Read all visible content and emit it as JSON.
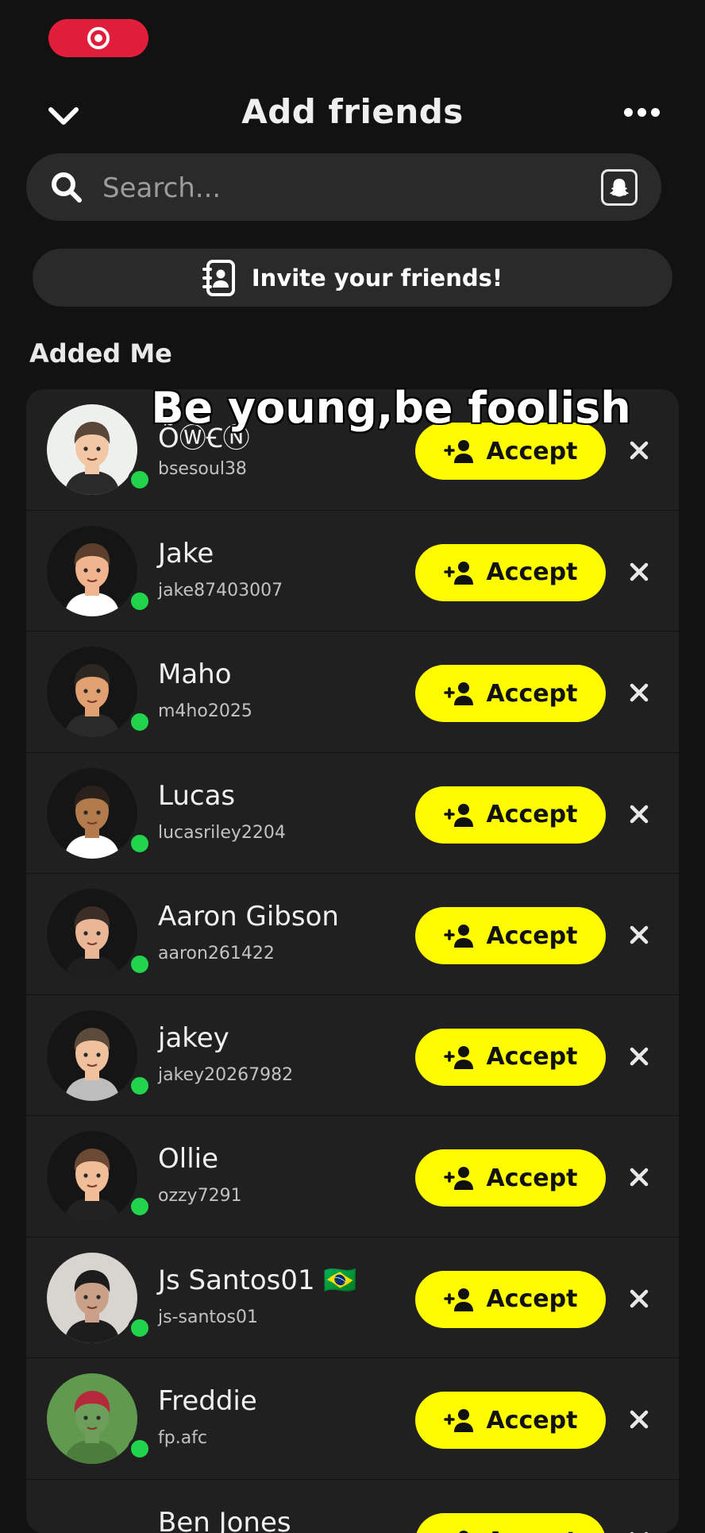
{
  "header": {
    "title": "Add friends",
    "chevron_icon": "chevron-down-icon",
    "more_icon": "more-horizontal-icon"
  },
  "search": {
    "placeholder": "Search...",
    "icon": "search-icon",
    "scan_icon": "snapcode-icon"
  },
  "invite": {
    "label": "Invite your friends!",
    "icon": "contact-book-icon"
  },
  "section_title": "Added Me",
  "accept_label": "Accept",
  "caption": "Be young,be foolish",
  "colors": {
    "accent": "#fffc00",
    "online": "#22d34c",
    "record": "#e01e3c"
  },
  "friends": [
    {
      "name": "ÕⓌꞒⓃ",
      "username": "bsesoul38",
      "avatar": {
        "skin": "#f1c7a6",
        "hair": "#5a4638",
        "bg": "#eef0ee",
        "shirt": "#2a2a2a"
      },
      "online": true
    },
    {
      "name": "Jake",
      "username": "jake87403007",
      "avatar": {
        "skin": "#f0b48e",
        "hair": "#5b3f2c",
        "bg": "#151515",
        "shirt": "#ffffff"
      },
      "online": true
    },
    {
      "name": "Maho",
      "username": "m4ho2025",
      "avatar": {
        "skin": "#e0a070",
        "hair": "#2d2722",
        "bg": "#151515",
        "shirt": "#2a2a2a"
      },
      "online": true
    },
    {
      "name": "Lucas",
      "username": "lucasriley2204",
      "avatar": {
        "skin": "#b37a4c",
        "hair": "#2a211c",
        "bg": "#151515",
        "shirt": "#ffffff"
      },
      "online": true
    },
    {
      "name": "Aaron Gibson",
      "username": "aaron261422",
      "avatar": {
        "skin": "#eab796",
        "hair": "#3b2e27",
        "bg": "#151515",
        "shirt": "#1e1e1e"
      },
      "online": true
    },
    {
      "name": "jakey",
      "username": "jakey20267982",
      "avatar": {
        "skin": "#efc19c",
        "hair": "#5c4a3b",
        "bg": "#151515",
        "shirt": "#bdbdbd"
      },
      "online": true
    },
    {
      "name": "Ollie",
      "username": "ozzy7291",
      "avatar": {
        "skin": "#efbd98",
        "hair": "#6b4a35",
        "bg": "#151515",
        "shirt": "#222222"
      },
      "online": true
    },
    {
      "name": "Js Santos01 🇧🇷",
      "username": "js-santos01",
      "avatar": {
        "skin": "#c9a088",
        "hair": "#1c1c1c",
        "bg": "#d8d4d0",
        "shirt": "#1d1d1d"
      },
      "online": true
    },
    {
      "name": "Freddie",
      "username": "fp.afc",
      "avatar": {
        "skin": "#6d9e5a",
        "hair": "#b5273a",
        "bg": "#5f9a4e",
        "shirt": "#4b7d3d"
      },
      "online": true
    },
    {
      "name": "Ben Jones",
      "username": "",
      "avatar": {
        "skin": "#202020",
        "hair": "#202020",
        "bg": "#202020",
        "shirt": "#202020"
      },
      "online": false
    }
  ]
}
